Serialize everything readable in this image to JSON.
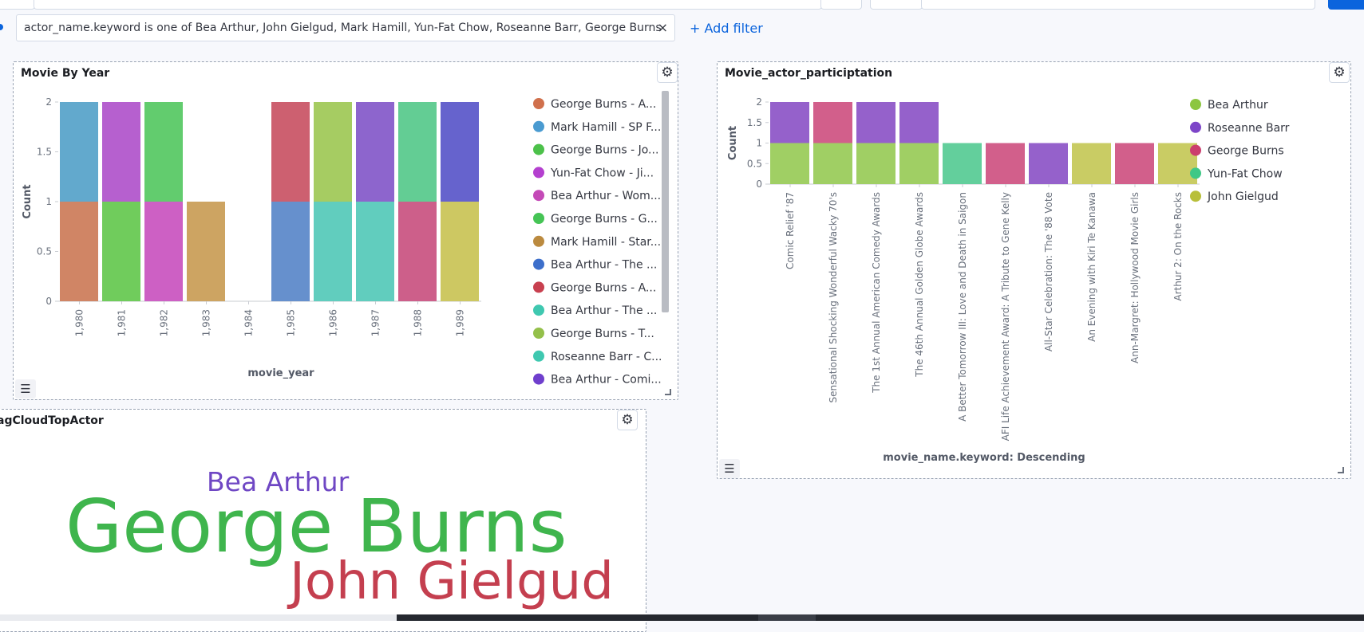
{
  "filter_bar": {
    "filter_text": "actor_name.keyword is one of Bea Arthur, John Gielgud, Mark Hamill, Yun-Fat Chow, Roseanne Barr, George Burns",
    "remove_symbol": "×",
    "add_filter_label": "+ Add filter"
  },
  "icons": {
    "gear": "gear-icon",
    "legend_toggle": "list-icon",
    "resize": "resize-handle-icon",
    "remove": "close-icon"
  },
  "panels": {
    "movie_by_year": {
      "title": "Movie By Year",
      "legend_toggle_symbol": "☰",
      "gear_symbol": "⚙"
    },
    "participation": {
      "title": "Movie_actor_participtation",
      "legend_toggle_symbol": "☰",
      "gear_symbol": "⚙"
    },
    "tag_cloud": {
      "title": "agCloudTopActor",
      "gear_symbol": "⚙",
      "words": [
        {
          "text": "Bea Arthur",
          "color": "#6f47c4"
        },
        {
          "text": "George Burns",
          "color": "#3fb54d"
        },
        {
          "text": "John Gielgud",
          "color": "#c43f4f"
        }
      ]
    }
  },
  "chart_data": [
    {
      "type": "bar",
      "stacked": true,
      "title": "Movie By Year",
      "xlabel": "movie_year",
      "ylabel": "Count",
      "ylim": [
        0,
        2
      ],
      "yticks": [
        "0",
        "0.5",
        "1",
        "1.5",
        "2"
      ],
      "categories": [
        "1,980",
        "1,981",
        "1,982",
        "1,983",
        "1,984",
        "1,985",
        "1,986",
        "1,987",
        "1,988",
        "1,989"
      ],
      "stacks": [
        [
          {
            "v": 1,
            "c": "#d08565"
          },
          {
            "v": 1,
            "c": "#62a9cd"
          }
        ],
        [
          {
            "v": 1,
            "c": "#70cc5c"
          },
          {
            "v": 1,
            "c": "#b660cf"
          }
        ],
        [
          {
            "v": 1,
            "c": "#cd60c4"
          },
          {
            "v": 1,
            "c": "#62cc6e"
          }
        ],
        [
          {
            "v": 1,
            "c": "#cda462"
          }
        ],
        [],
        [
          {
            "v": 1,
            "c": "#6690cd"
          },
          {
            "v": 1,
            "c": "#cd6070"
          }
        ],
        [
          {
            "v": 1,
            "c": "#61cdbe"
          },
          {
            "v": 1,
            "c": "#a6cc62"
          }
        ],
        [
          {
            "v": 1,
            "c": "#61cdbe"
          },
          {
            "v": 1,
            "c": "#8d65cd"
          }
        ],
        [
          {
            "v": 1,
            "c": "#cd5f8a"
          },
          {
            "v": 1,
            "c": "#63cd94"
          }
        ],
        [
          {
            "v": 1,
            "c": "#cdc862"
          },
          {
            "v": 1,
            "c": "#6663cd"
          }
        ]
      ],
      "legend": [
        {
          "label": "George Burns - A...",
          "color": "#d0704c"
        },
        {
          "label": "Mark Hamill - SP F...",
          "color": "#4a9bd1"
        },
        {
          "label": "George Burns - Jo...",
          "color": "#4cc14a"
        },
        {
          "label": "Yun-Fat Chow - Ji...",
          "color": "#b440cf"
        },
        {
          "label": "Bea Arthur - Wom...",
          "color": "#c44ab7"
        },
        {
          "label": "George Burns - G...",
          "color": "#45c455"
        },
        {
          "label": "Mark Hamill - Star...",
          "color": "#bb8a3f"
        },
        {
          "label": "Bea Arthur - The ...",
          "color": "#3d6fcb"
        },
        {
          "label": "George Burns - A...",
          "color": "#c8404f"
        },
        {
          "label": "Bea Arthur - The ...",
          "color": "#3fc8b0"
        },
        {
          "label": "George Burns - T...",
          "color": "#94c04a"
        },
        {
          "label": "Roseanne Barr - C...",
          "color": "#3fc8b0"
        },
        {
          "label": "Bea Arthur - Comi...",
          "color": "#6f3fcd"
        }
      ]
    },
    {
      "type": "bar",
      "stacked": true,
      "title": "Movie_actor_participtation",
      "xlabel": "movie_name.keyword: Descending",
      "ylabel": "Count",
      "ylim": [
        0,
        2
      ],
      "yticks": [
        "0",
        "0.5",
        "1",
        "1.5",
        "2"
      ],
      "categories": [
        "Comic Relief '87",
        "Sensational Shocking Wonderful Wacky 70's",
        "The 1st Annual American Comedy Awards",
        "The 46th Annual Golden Globe Awards",
        "A Better Tomorrow III: Love and Death in Saigon",
        "AFI Life Achievement Award: A Tribute to Gene Kelly",
        "All-Star Celebration: The '88 Vote",
        "An Evening with Kiri Te Kanawa",
        "Ann-Margret: Hollywood Movie Girls",
        "Arthur 2: On the Rocks"
      ],
      "series": [
        {
          "name": "Bea Arthur",
          "color": "#a0cf64",
          "values": [
            1,
            1,
            1,
            1,
            0,
            0,
            0,
            0,
            0,
            0
          ]
        },
        {
          "name": "Roseanne Barr",
          "color": "#9561cb",
          "values": [
            1,
            0,
            1,
            1,
            0,
            0,
            1,
            0,
            0,
            0
          ]
        },
        {
          "name": "George Burns",
          "color": "#d25f8b",
          "values": [
            0,
            1,
            0,
            0,
            0,
            1,
            0,
            0,
            1,
            0
          ]
        },
        {
          "name": "Yun-Fat Chow",
          "color": "#63cf9c",
          "values": [
            0,
            0,
            0,
            0,
            1,
            0,
            0,
            0,
            0,
            0
          ]
        },
        {
          "name": "John Gielgud",
          "color": "#c9cc64",
          "values": [
            0,
            0,
            0,
            0,
            0,
            0,
            0,
            1,
            0,
            1
          ]
        }
      ],
      "legend": [
        {
          "label": "Bea Arthur",
          "color": "#8cc640"
        },
        {
          "label": "Roseanne Barr",
          "color": "#7d45c8"
        },
        {
          "label": "George Burns",
          "color": "#cb3f6e"
        },
        {
          "label": "Yun-Fat Chow",
          "color": "#3fc886"
        },
        {
          "label": "John Gielgud",
          "color": "#b8bf3a"
        }
      ]
    }
  ]
}
